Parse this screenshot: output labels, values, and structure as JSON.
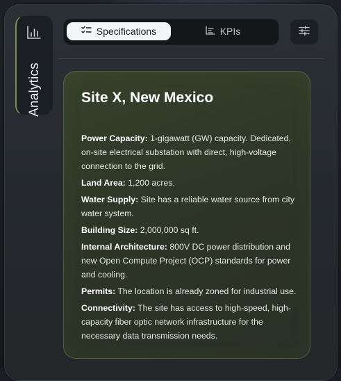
{
  "sidebar": {
    "tab_label": "Analytics",
    "tab_icon": "bar-chart-icon"
  },
  "tabs": [
    {
      "label": "Specifications",
      "icon": "list-checks-icon",
      "active": true
    },
    {
      "label": "KPIs",
      "icon": "bar-chart-horizontal-icon",
      "active": false
    }
  ],
  "settings_icon": "sliders-icon",
  "card": {
    "title": "Site X, New Mexico",
    "specs": [
      {
        "key": "Power Capacity:",
        "value": "1-gigawatt (GW) capacity. Dedicated, on-site electrical substation with direct, high-voltage connection to the grid."
      },
      {
        "key": "Land Area:",
        "value": "1,200 acres."
      },
      {
        "key": "Water Supply:",
        "value": "Site has a reliable water source from city water system."
      },
      {
        "key": "Building Size:",
        "value": "2,000,000 sq ft."
      },
      {
        "key": "Internal Architecture:",
        "value": "800V DC power distribution and new Open Compute Project (OCP) standards for power and cooling."
      },
      {
        "key": "Permits:",
        "value": "The location is already zoned for industrial use."
      },
      {
        "key": "Connectivity:",
        "value": "The site has access to high-speed, high-capacity fiber optic network infrastructure for the necessary data transmission needs."
      }
    ]
  },
  "colors": {
    "accent": "#7c8a4a",
    "card_border": "#96aa6e"
  }
}
